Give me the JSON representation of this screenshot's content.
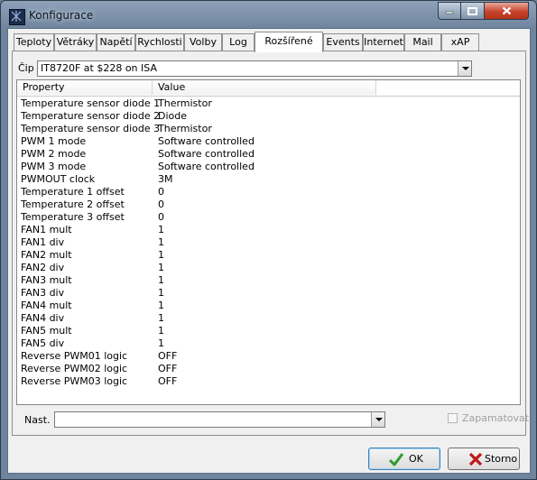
{
  "window": {
    "title": "Konfigurace"
  },
  "tabs": [
    {
      "label": "Teploty"
    },
    {
      "label": "Větráky"
    },
    {
      "label": "Napětí"
    },
    {
      "label": "Rychlosti"
    },
    {
      "label": "Volby"
    },
    {
      "label": "Log"
    },
    {
      "label": "Rozšířené",
      "active": true
    },
    {
      "label": "Events"
    },
    {
      "label": "Internet"
    },
    {
      "label": "Mail"
    },
    {
      "label": "xAP"
    }
  ],
  "chip": {
    "label": "Čip",
    "value": "IT8720F at $228 on ISA"
  },
  "table": {
    "columns": [
      "Property",
      "Value"
    ],
    "rows": [
      [
        "Temperature sensor diode 1",
        "Thermistor"
      ],
      [
        "Temperature sensor diode 2",
        "Diode"
      ],
      [
        "Temperature sensor diode 3",
        "Thermistor"
      ],
      [
        "PWM 1 mode",
        "Software controlled"
      ],
      [
        "PWM 2 mode",
        "Software controlled"
      ],
      [
        "PWM 3 mode",
        "Software controlled"
      ],
      [
        "PWMOUT clock",
        "3M"
      ],
      [
        "Temperature 1 offset",
        "0"
      ],
      [
        "Temperature 2 offset",
        "0"
      ],
      [
        "Temperature 3 offset",
        "0"
      ],
      [
        "FAN1 mult",
        "1"
      ],
      [
        "FAN1 div",
        "1"
      ],
      [
        "FAN2 mult",
        "1"
      ],
      [
        "FAN2 div",
        "1"
      ],
      [
        "FAN3 mult",
        "1"
      ],
      [
        "FAN3 div",
        "1"
      ],
      [
        "FAN4 mult",
        "1"
      ],
      [
        "FAN4 div",
        "1"
      ],
      [
        "FAN5 mult",
        "1"
      ],
      [
        "FAN5 div",
        "1"
      ],
      [
        "Reverse PWM01 logic",
        "OFF"
      ],
      [
        "Reverse PWM02 logic",
        "OFF"
      ],
      [
        "Reverse PWM03 logic",
        "OFF"
      ]
    ]
  },
  "preset": {
    "label": "Nast.",
    "value": ""
  },
  "remember": {
    "label": "Zapamatovat",
    "checked": false,
    "enabled": false
  },
  "buttons": {
    "ok": "OK",
    "cancel": "Storno"
  },
  "icons": {
    "app": "app-icon",
    "ok": "check-icon",
    "cancel": "x-icon"
  },
  "colors": {
    "ok_icon": "#2e9b2e",
    "cancel_icon": "#c01818",
    "close_button": "#c8442c"
  }
}
